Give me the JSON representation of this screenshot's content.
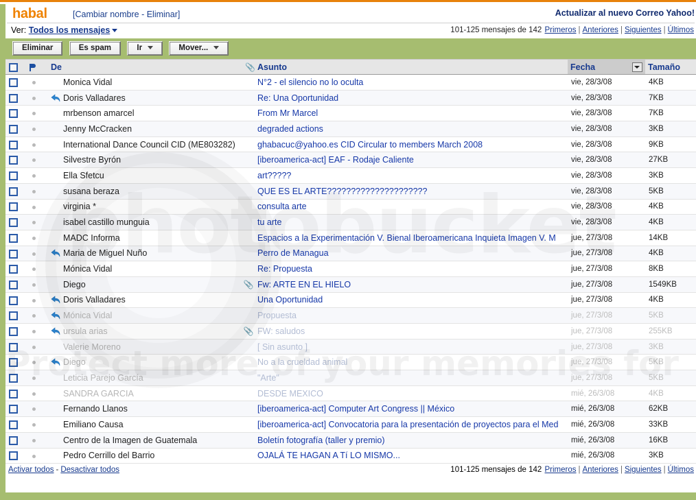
{
  "account": {
    "name": "habal",
    "links_open": "[",
    "rename_label": "Cambiar nombre",
    "sep": "-",
    "delete_label": "Eliminar",
    "links_close": "]",
    "upgrade_label": "Actualizar al nuevo Correo Yahoo!"
  },
  "view": {
    "label": "Ver:",
    "selected": "Todos los mensajes"
  },
  "pager": {
    "count_text": "101-125 mensajes de 142",
    "first": "Primeros",
    "prev": "Anteriores",
    "next": "Siguientes",
    "last": "Últimos",
    "separator": "|"
  },
  "toolbar": {
    "delete_label": "Eliminar",
    "spam_label": "Es spam",
    "go_label": "Ir",
    "move_label": "Mover..."
  },
  "columns": {
    "checkbox": "",
    "flag": "flag-icon",
    "from": "De",
    "attachment": "paperclip-icon",
    "subject": "Asunto",
    "date": "Fecha",
    "size": "Tamaño",
    "sorted_column": "Fecha"
  },
  "footer": {
    "select_all": "Activar todos",
    "dash": "-",
    "deselect_all": "Desactivar todos"
  },
  "watermark": {
    "word": "photobucket",
    "tagline": "Protect more of your memories for"
  },
  "colors": {
    "brand_orange": "#ef8200",
    "toolbar_green": "#a6bd70",
    "link_blue": "#1638a8",
    "header_blue": "#16398e"
  },
  "messages": [
    {
      "from": "Monica Vidal",
      "subject": "N°2 - el silencio no lo oculta",
      "date": "vie, 28/3/08",
      "size": "4KB",
      "replied": false,
      "attachment": false,
      "faded": false
    },
    {
      "from": "Doris Valladares",
      "subject": "Re: Una Oportunidad",
      "date": "vie, 28/3/08",
      "size": "7KB",
      "replied": true,
      "attachment": false,
      "faded": false
    },
    {
      "from": "mrbenson amarcel",
      "subject": "From Mr Marcel",
      "date": "vie, 28/3/08",
      "size": "7KB",
      "replied": false,
      "attachment": false,
      "faded": false
    },
    {
      "from": "Jenny McCracken",
      "subject": "degraded actions",
      "date": "vie, 28/3/08",
      "size": "3KB",
      "replied": false,
      "attachment": false,
      "faded": false
    },
    {
      "from": "International Dance Council CID (ME803282)",
      "subject": "ghabacuc@yahoo.es CID Circular to members March 2008",
      "date": "vie, 28/3/08",
      "size": "9KB",
      "replied": false,
      "attachment": false,
      "faded": false
    },
    {
      "from": "Silvestre Byrón",
      "subject": "[iberoamerica-act] EAF - Rodaje Caliente",
      "date": "vie, 28/3/08",
      "size": "27KB",
      "replied": false,
      "attachment": false,
      "faded": false
    },
    {
      "from": "Ella Sfetcu",
      "subject": "art?????",
      "date": "vie, 28/3/08",
      "size": "3KB",
      "replied": false,
      "attachment": false,
      "faded": false
    },
    {
      "from": "susana beraza",
      "subject": "QUE ES EL ARTE?????????????????????",
      "date": "vie, 28/3/08",
      "size": "5KB",
      "replied": false,
      "attachment": false,
      "faded": false
    },
    {
      "from": "virginia *",
      "subject": "consulta arte",
      "date": "vie, 28/3/08",
      "size": "4KB",
      "replied": false,
      "attachment": false,
      "faded": false
    },
    {
      "from": "isabel castillo munguia",
      "subject": "tu arte",
      "date": "vie, 28/3/08",
      "size": "4KB",
      "replied": false,
      "attachment": false,
      "faded": false
    },
    {
      "from": "MADC Informa",
      "subject": "Espacios a la Experimentación V. Bienal Iberoamericana Inquieta Imagen V. M",
      "date": "jue, 27/3/08",
      "size": "14KB",
      "replied": false,
      "attachment": false,
      "faded": false
    },
    {
      "from": "Maria de Miguel Nuño",
      "subject": "Perro de Managua",
      "date": "jue, 27/3/08",
      "size": "4KB",
      "replied": true,
      "attachment": false,
      "faded": false
    },
    {
      "from": "Mónica Vidal",
      "subject": "Re: Propuesta",
      "date": "jue, 27/3/08",
      "size": "8KB",
      "replied": false,
      "attachment": false,
      "faded": false
    },
    {
      "from": "Diego",
      "subject": "Fw: ARTE EN EL HIELO",
      "date": "jue, 27/3/08",
      "size": "1549KB",
      "replied": false,
      "attachment": true,
      "faded": false
    },
    {
      "from": "Doris Valladares",
      "subject": "Una Oportunidad",
      "date": "jue, 27/3/08",
      "size": "4KB",
      "replied": true,
      "attachment": false,
      "faded": false
    },
    {
      "from": "Mónica Vidal",
      "subject": "Propuesta",
      "date": "jue, 27/3/08",
      "size": "5KB",
      "replied": true,
      "attachment": false,
      "faded": true
    },
    {
      "from": "ursula arias",
      "subject": "FW: saludos",
      "date": "jue, 27/3/08",
      "size": "255KB",
      "replied": true,
      "attachment": true,
      "faded": true
    },
    {
      "from": "Valerie Moreno",
      "subject": "[ Sin asunto ]",
      "date": "jue, 27/3/08",
      "size": "3KB",
      "replied": false,
      "attachment": false,
      "faded": true
    },
    {
      "from": "Diego",
      "subject": "No a la crueldad animal",
      "date": "jue, 27/3/08",
      "size": "5KB",
      "replied": true,
      "attachment": false,
      "faded": true
    },
    {
      "from": "Leticia Parejo García",
      "subject": "\"Arte\"",
      "date": "jue, 27/3/08",
      "size": "5KB",
      "replied": false,
      "attachment": false,
      "faded": true
    },
    {
      "from": "SANDRA GARCIA",
      "subject": "DESDE MEXICO",
      "date": "mié, 26/3/08",
      "size": "4KB",
      "replied": false,
      "attachment": false,
      "faded": true
    },
    {
      "from": "Fernando Llanos",
      "subject": "[iberoamerica-act] Computer Art Congress || México",
      "date": "mié, 26/3/08",
      "size": "62KB",
      "replied": false,
      "attachment": false,
      "faded": false
    },
    {
      "from": "Emiliano Causa",
      "subject": "[iberoamerica-act] Convocatoria para la presentación de proyectos para el Med",
      "date": "mié, 26/3/08",
      "size": "33KB",
      "replied": false,
      "attachment": false,
      "faded": false
    },
    {
      "from": "Centro de la Imagen de Guatemala",
      "subject": "Boletín fotografía (taller y premio)",
      "date": "mié, 26/3/08",
      "size": "16KB",
      "replied": false,
      "attachment": false,
      "faded": false
    },
    {
      "from": "Pedro Cerrillo del Barrio",
      "subject": "OJALÁ TE HAGAN A Tí LO MISMO...",
      "date": "mié, 26/3/08",
      "size": "3KB",
      "replied": false,
      "attachment": false,
      "faded": false
    }
  ]
}
